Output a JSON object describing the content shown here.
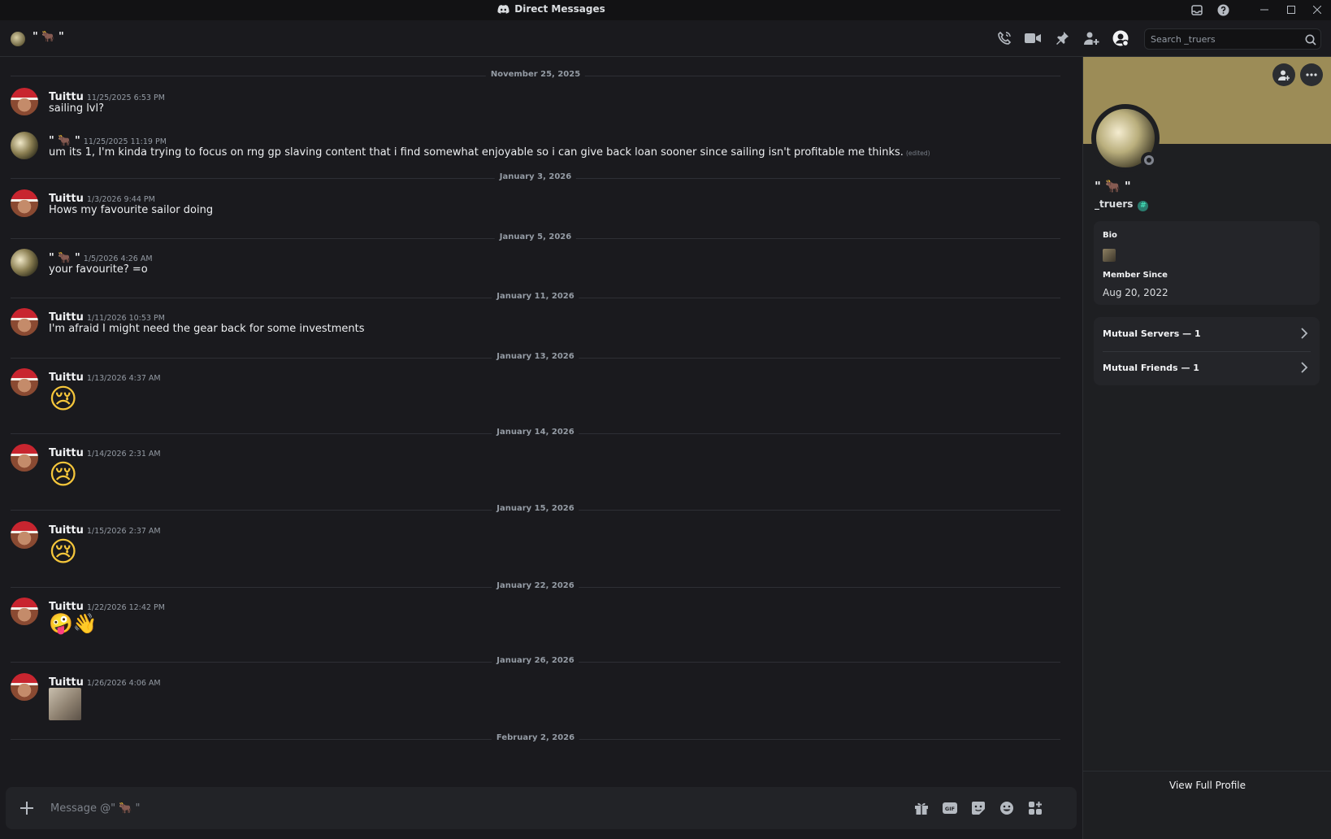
{
  "window": {
    "title": "Direct Messages"
  },
  "header": {
    "display_name": "\" 🐂 \"",
    "search_placeholder": "Search _truers"
  },
  "messages": [
    {
      "type": "divider",
      "date": "November 25, 2025"
    },
    {
      "type": "message",
      "author": "Tuittu",
      "avatar": "tuittu",
      "timestamp": "11/25/2025 6:53 PM",
      "text": "sailing lvl?"
    },
    {
      "type": "message",
      "author": "\" 🐂 \"",
      "avatar": "truers",
      "timestamp": "11/25/2025 11:19 PM",
      "text": "um its 1, I'm kinda trying to focus on rng gp slaving content that  i  find somewhat enjoyable so i can give back loan sooner since sailing isn't profitable me thinks.",
      "edited": "(edited)"
    },
    {
      "type": "divider",
      "date": "January 3, 2026"
    },
    {
      "type": "message",
      "author": "Tuittu",
      "avatar": "tuittu",
      "timestamp": "1/3/2026 9:44 PM",
      "text": "Hows my favourite sailor doing"
    },
    {
      "type": "divider",
      "date": "January 5, 2026"
    },
    {
      "type": "message",
      "author": "\" 🐂 \"",
      "avatar": "truers",
      "timestamp": "1/5/2026 4:26 AM",
      "text": "your favourite? =o"
    },
    {
      "type": "divider",
      "date": "January 11, 2026"
    },
    {
      "type": "message",
      "author": "Tuittu",
      "avatar": "tuittu",
      "timestamp": "1/11/2026 10:53 PM",
      "text": "I'm afraid I might need the gear back for some investments"
    },
    {
      "type": "divider",
      "date": "January 13, 2026"
    },
    {
      "type": "message",
      "author": "Tuittu",
      "avatar": "tuittu",
      "timestamp": "1/13/2026 4:37 AM",
      "emoji": "😢"
    },
    {
      "type": "divider",
      "date": "January 14, 2026"
    },
    {
      "type": "message",
      "author": "Tuittu",
      "avatar": "tuittu",
      "timestamp": "1/14/2026 2:31 AM",
      "emoji": "😢"
    },
    {
      "type": "divider",
      "date": "January 15, 2026"
    },
    {
      "type": "message",
      "author": "Tuittu",
      "avatar": "tuittu",
      "timestamp": "1/15/2026 2:37 AM",
      "emoji": "😢"
    },
    {
      "type": "divider",
      "date": "January 22, 2026"
    },
    {
      "type": "message",
      "author": "Tuittu",
      "avatar": "tuittu",
      "timestamp": "1/22/2026 12:42 PM",
      "emoji_small": "🤪👋"
    },
    {
      "type": "divider",
      "date": "January 26, 2026"
    },
    {
      "type": "message",
      "author": "Tuittu",
      "avatar": "tuittu",
      "timestamp": "1/26/2026 4:06 AM",
      "attachment": "image"
    },
    {
      "type": "divider",
      "date": "February 2, 2026"
    }
  ],
  "composer": {
    "placeholder": "Message @\" 🐂 \""
  },
  "profile": {
    "display_name": "\" 🐂 \"",
    "username": "_truers",
    "badge": "#",
    "bio_label": "Bio",
    "member_since_label": "Member Since",
    "member_since": "Aug 20, 2022",
    "mutual_servers": "Mutual Servers — 1",
    "mutual_friends": "Mutual Friends — 1",
    "view_full_profile": "View Full Profile",
    "banner_color": "#9c8c57"
  },
  "icons": {
    "header": [
      "voice-call-icon",
      "video-call-icon",
      "pinned-messages-icon",
      "add-friends-to-dm-icon",
      "user-profile-icon",
      "search-icon"
    ],
    "composer": [
      "gift-icon",
      "gif-icon",
      "sticker-icon",
      "emoji-icon",
      "apps-icon"
    ],
    "window": [
      "inbox-icon",
      "help-icon",
      "minimize-icon",
      "maximize-icon",
      "close-icon"
    ]
  }
}
